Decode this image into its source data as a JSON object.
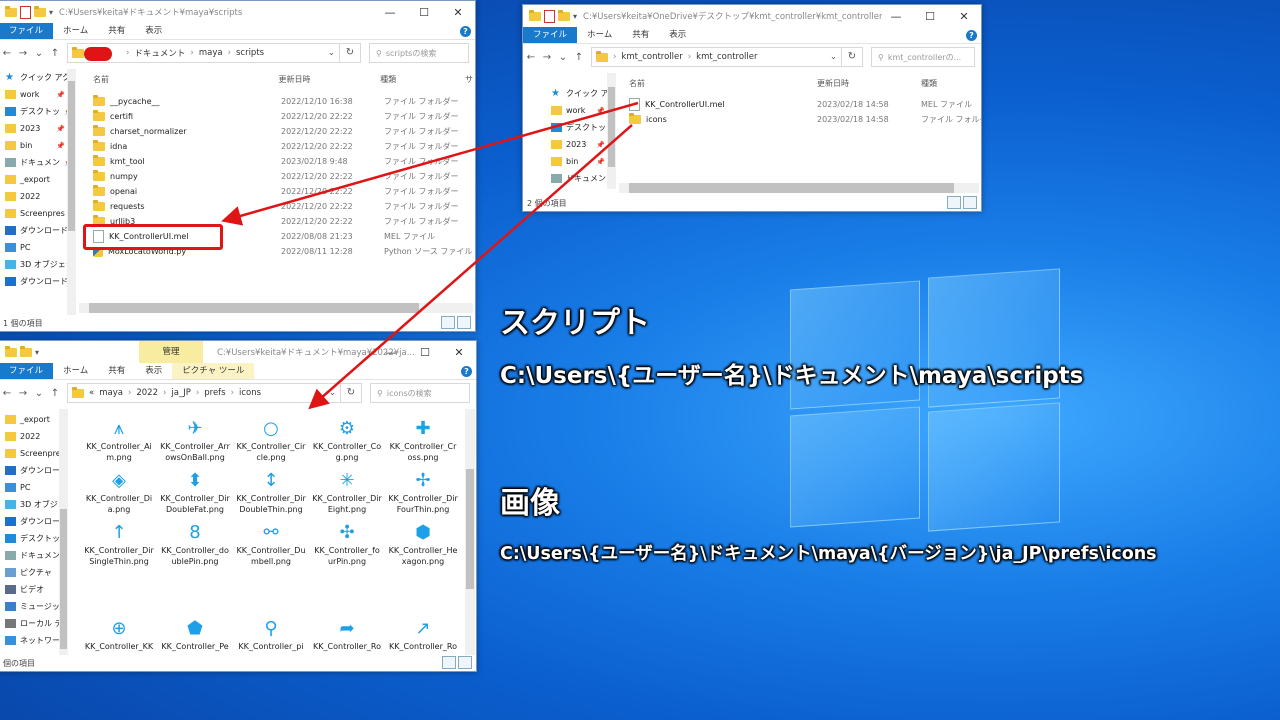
{
  "colors": {
    "accent": "#1979ca",
    "folder": "#f5c842",
    "annotation": "#e01414",
    "icon": "#1ea0e8"
  },
  "explorer_common": {
    "ribbon_file": "ファイル",
    "ribbon_home": "ホーム",
    "ribbon_share": "共有",
    "ribbon_view": "表示",
    "help": "?",
    "back": "←",
    "forward": "→",
    "recent": "⌄",
    "up": "↑",
    "refresh": "↻",
    "dropdown": "⌄",
    "minimize": "—",
    "maximize": "☐",
    "close": "✕"
  },
  "win_scripts": {
    "title": "C:¥Users¥keita¥ドキュメント¥maya¥scripts",
    "breadcrumb": [
      "ドキュメント",
      "maya",
      "scripts"
    ],
    "search_placeholder": "scriptsの検索",
    "nav": [
      {
        "label": "クイック アクセ",
        "icon": "star-icon"
      },
      {
        "label": "work",
        "icon": "folder-icon",
        "pin": "📌"
      },
      {
        "label": "デスクトッ",
        "icon": "desktop-icon",
        "pin": "📌"
      },
      {
        "label": "2023",
        "icon": "folder-icon",
        "pin": "📌"
      },
      {
        "label": "bin",
        "icon": "folder-icon",
        "pin": "📌"
      },
      {
        "label": "ドキュメン",
        "icon": "document-icon",
        "pin": "📌"
      },
      {
        "label": "_export",
        "icon": "folder-icon"
      },
      {
        "label": "2022",
        "icon": "folder-icon"
      },
      {
        "label": "Screenpres",
        "icon": "folder-icon"
      },
      {
        "label": "ダウンロード",
        "icon": "download-icon"
      },
      {
        "label": "PC",
        "icon": "pc-icon"
      },
      {
        "label": "3D オブジェク",
        "icon": "cube-icon"
      },
      {
        "label": "ダウンロード",
        "icon": "download-icon"
      }
    ],
    "columns": {
      "name": "名前",
      "date": "更新日時",
      "type": "種類",
      "extra": "サ"
    },
    "files": [
      {
        "name": "__pycache__",
        "date": "2022/12/10 16:38",
        "type": "ファイル フォルダー",
        "kind": "folder"
      },
      {
        "name": "certifi",
        "date": "2022/12/20 22:22",
        "type": "ファイル フォルダー",
        "kind": "folder"
      },
      {
        "name": "charset_normalizer",
        "date": "2022/12/20 22:22",
        "type": "ファイル フォルダー",
        "kind": "folder"
      },
      {
        "name": "idna",
        "date": "2022/12/20 22:22",
        "type": "ファイル フォルダー",
        "kind": "folder"
      },
      {
        "name": "kmt_tool",
        "date": "2023/02/18 9:48",
        "type": "ファイル フォルダー",
        "kind": "folder"
      },
      {
        "name": "numpy",
        "date": "2022/12/20 22:22",
        "type": "ファイル フォルダー",
        "kind": "folder"
      },
      {
        "name": "openai",
        "date": "2022/12/20 22:22",
        "type": "ファイル フォルダー",
        "kind": "folder"
      },
      {
        "name": "requests",
        "date": "2022/12/20 22:22",
        "type": "ファイル フォルダー",
        "kind": "folder"
      },
      {
        "name": "urllib3",
        "date": "2022/12/20 22:22",
        "type": "ファイル フォルダー",
        "kind": "folder"
      },
      {
        "name": "KK_ControllerUI.mel",
        "date": "2022/08/08 21:23",
        "type": "MEL ファイル",
        "kind": "file"
      },
      {
        "name": "MoxLocatoWorld.py",
        "date": "2022/08/11 12:28",
        "type": "Python ソース ファイル",
        "kind": "py"
      }
    ],
    "status": "1 個の項目"
  },
  "win_controller": {
    "title": "C:¥Users¥keita¥OneDrive¥デスクトップ¥kmt_controller¥kmt_controller",
    "breadcrumb": [
      "kmt_controller",
      "kmt_controller"
    ],
    "search_placeholder": "kmt_controllerの...",
    "nav": [
      {
        "label": "クイック アクセ",
        "icon": "star-icon"
      },
      {
        "label": "work",
        "icon": "folder-icon",
        "pin": "📌"
      },
      {
        "label": "デスクトッ",
        "icon": "desktop-icon",
        "pin": "📌"
      },
      {
        "label": "2023",
        "icon": "folder-icon",
        "pin": "📌"
      },
      {
        "label": "bin",
        "icon": "folder-icon",
        "pin": "📌"
      },
      {
        "label": "ドキュメン",
        "icon": "document-icon",
        "pin": "📌"
      }
    ],
    "columns": {
      "name": "名前",
      "date": "更新日時",
      "type": "種類"
    },
    "files": [
      {
        "name": "KK_ControllerUI.mel",
        "date": "2023/02/18 14:58",
        "type": "MEL ファイル",
        "kind": "file"
      },
      {
        "name": "icons",
        "date": "2023/02/18 14:58",
        "type": "ファイル フォルダー",
        "kind": "folder"
      }
    ],
    "status": "2 個の項目"
  },
  "win_icons": {
    "title": "C:¥Users¥keita¥ドキュメント¥maya¥2022¥ja...",
    "manage_tab": "管理",
    "picture_tools": "ピクチャ ツール",
    "breadcrumb": [
      "«",
      "maya",
      "2022",
      "ja_JP",
      "prefs",
      "icons"
    ],
    "search_placeholder": "iconsの検索",
    "nav": [
      {
        "label": "_export",
        "icon": "folder-icon"
      },
      {
        "label": "2022",
        "icon": "folder-icon"
      },
      {
        "label": "Screenpres",
        "icon": "folder-icon"
      },
      {
        "label": "ダウンロード",
        "icon": "download-icon"
      },
      {
        "label": "PC",
        "icon": "pc-icon"
      },
      {
        "label": "3D オブジェク",
        "icon": "cube-icon"
      },
      {
        "label": "ダウンロード",
        "icon": "download-icon"
      },
      {
        "label": "デスクトップ",
        "icon": "desktop-icon"
      },
      {
        "label": "ドキュメント",
        "icon": "document-icon"
      },
      {
        "label": "ピクチャ",
        "icon": "picture-icon"
      },
      {
        "label": "ビデオ",
        "icon": "video-icon"
      },
      {
        "label": "ミュージック",
        "icon": "music-icon"
      },
      {
        "label": "ローカル ディ",
        "icon": "drive-icon"
      },
      {
        "label": "ネットワーク",
        "icon": "network-icon"
      }
    ],
    "icons": [
      {
        "l1": "KK_Controller_Ai",
        "l2": "m.png",
        "glyph": "⩚",
        "icon": "aim-controller-icon"
      },
      {
        "l1": "KK_Controller_Arr",
        "l2": "owsOnBall.png",
        "glyph": "✈",
        "icon": "arrows-on-ball-controller-icon"
      },
      {
        "l1": "KK_Controller_Cir",
        "l2": "cle.png",
        "glyph": "○",
        "icon": "circle-controller-icon"
      },
      {
        "l1": "KK_Controller_Co",
        "l2": "g.png",
        "glyph": "⚙",
        "icon": "cog-controller-icon"
      },
      {
        "l1": "KK_Controller_Cr",
        "l2": "oss.png",
        "glyph": "✚",
        "icon": "cross-controller-icon"
      },
      {
        "l1": "KK_Controller_Di",
        "l2": "a.png",
        "glyph": "◈",
        "icon": "dia-controller-icon"
      },
      {
        "l1": "KK_Controller_Dir",
        "l2": "DoubleFat.png",
        "glyph": "⬍",
        "icon": "dir-double-fat-controller-icon"
      },
      {
        "l1": "KK_Controller_Dir",
        "l2": "DoubleThin.png",
        "glyph": "↕",
        "icon": "dir-double-thin-controller-icon"
      },
      {
        "l1": "KK_Controller_Dir",
        "l2": "Eight.png",
        "glyph": "✳",
        "icon": "dir-eight-controller-icon"
      },
      {
        "l1": "KK_Controller_Dir",
        "l2": "FourThin.png",
        "glyph": "✢",
        "icon": "dir-four-thin-controller-icon"
      },
      {
        "l1": "KK_Controller_Dir",
        "l2": "SingleThin.png",
        "glyph": "↑",
        "icon": "dir-single-thin-controller-icon"
      },
      {
        "l1": "KK_Controller_do",
        "l2": "ublePin.png",
        "glyph": "8",
        "icon": "double-pin-controller-icon"
      },
      {
        "l1": "KK_Controller_Du",
        "l2": "mbell.png",
        "glyph": "⚯",
        "icon": "dumbbell-controller-icon"
      },
      {
        "l1": "KK_Controller_fo",
        "l2": "urPin.png",
        "glyph": "✣",
        "icon": "four-pin-controller-icon"
      },
      {
        "l1": "KK_Controller_He",
        "l2": "xagon.png",
        "glyph": "⬢",
        "icon": "hexagon-controller-icon"
      },
      {
        "l1": "KK_Controller_KK",
        "l2": "",
        "glyph": "⊕",
        "icon": "kk-controller-icon"
      },
      {
        "l1": "KK_Controller_Pe",
        "l2": "",
        "glyph": "⬟",
        "icon": "pentagon-controller-icon"
      },
      {
        "l1": "KK_Controller_pi",
        "l2": "",
        "glyph": "⚲",
        "icon": "pin-controller-icon"
      },
      {
        "l1": "KK_Controller_Ro",
        "l2": "",
        "glyph": "➦",
        "icon": "rotate-controller-icon"
      },
      {
        "l1": "KK_Controller_Ro",
        "l2": "",
        "glyph": "↗",
        "icon": "rotate2-controller-icon"
      }
    ],
    "status": "個の項目"
  },
  "annotations": {
    "script_heading": "スクリプト",
    "script_path": "C:\\Users\\{ユーザー名}\\ドキュメント\\maya\\scripts",
    "image_heading": "画像",
    "image_path": "C:\\Users\\{ユーザー名}\\ドキュメント\\maya\\{バージョン}\\ja_JP\\prefs\\icons"
  }
}
